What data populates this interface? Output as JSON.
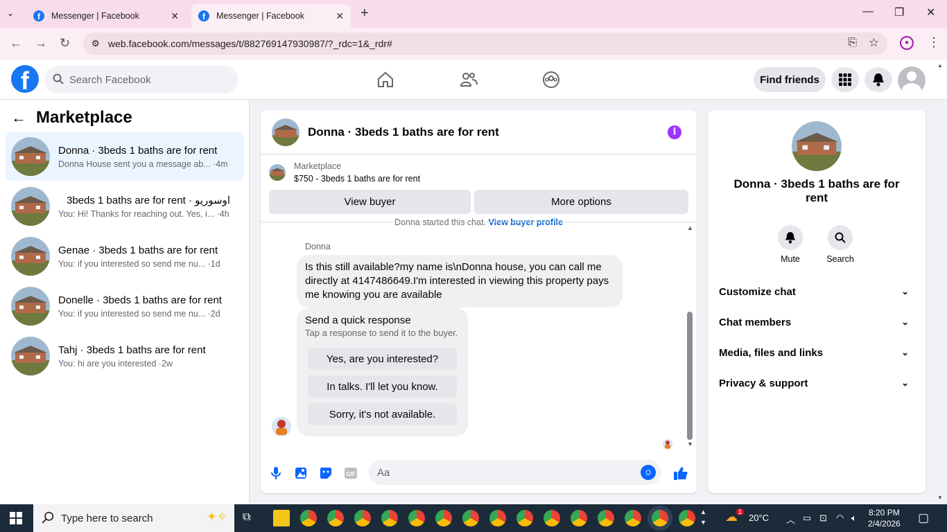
{
  "browser": {
    "tabs": [
      {
        "title": "Messenger | Facebook",
        "active": false
      },
      {
        "title": "Messenger | Facebook",
        "active": true
      }
    ],
    "url": "web.facebook.com/messages/t/882769147930987/?_rdc=1&_rdr#"
  },
  "fb_header": {
    "search_placeholder": "Search Facebook",
    "find_friends": "Find friends"
  },
  "sidebar": {
    "title": "Marketplace",
    "conversations": [
      {
        "title": "Donna · 3beds 1 baths are for rent",
        "preview": "Donna House sent you a message ab... ·4m",
        "selected": true
      },
      {
        "title": "3beds 1 baths are for rent · اوسوريو",
        "preview": "You: Hi! Thanks for reaching out. Yes, i... ·4h",
        "selected": false
      },
      {
        "title": "Genae · 3beds 1 baths are for rent",
        "preview": "You: if you interested so send me nu... ·1d",
        "selected": false
      },
      {
        "title": "Donelle · 3beds 1 baths are for rent",
        "preview": "You: if you interested so send me nu... ·2d",
        "selected": false
      },
      {
        "title": "Tahj · 3beds 1 baths are for rent",
        "preview": "You: hi are you interested ·2w",
        "selected": false
      }
    ]
  },
  "chat": {
    "title": "Donna · 3beds 1 baths are for rent",
    "marketplace_label": "Marketplace",
    "listing": "$750 - 3beds 1 baths are for rent",
    "view_buyer": "View buyer",
    "more_options": "More options",
    "started_text": "Donna started this chat.",
    "view_buyer_profile": "View buyer profile",
    "sender": "Donna",
    "message": "Is this still available?my name is\\nDonna house, you can call me directly at 4147486649.I'm interested in viewing this property pays me knowing you are available",
    "quick_title": "Send a quick response",
    "quick_sub": "Tap a response to send it to the buyer.",
    "quick_responses": [
      "Yes, are you interested?",
      "In talks. I'll let you know.",
      "Sorry, it's not available."
    ],
    "composer_placeholder": "Aa"
  },
  "details": {
    "name": "Donna · 3beds 1 baths are for rent",
    "mute": "Mute",
    "search": "Search",
    "sections": [
      "Customize chat",
      "Chat members",
      "Media, files and links",
      "Privacy & support"
    ]
  },
  "taskbar": {
    "search_placeholder": "Type here to search",
    "temperature": "20°C",
    "weather_badge": "1",
    "time": "8:20 PM",
    "date": "2/4/2026"
  }
}
